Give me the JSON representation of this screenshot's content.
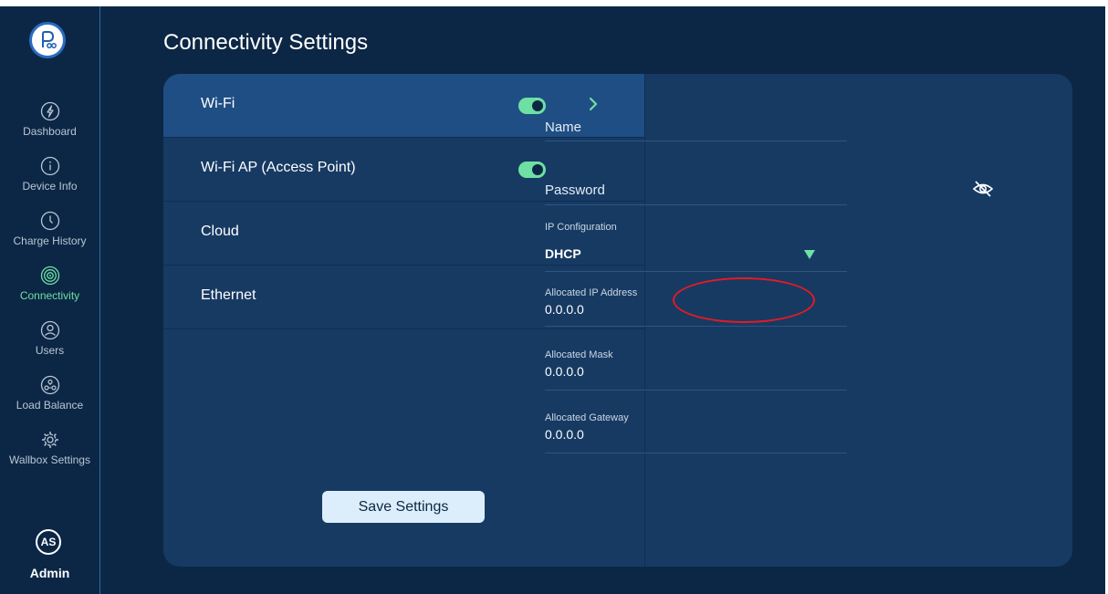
{
  "page": {
    "title": "Connectivity Settings"
  },
  "sidebar": {
    "items": [
      {
        "label": "Dashboard",
        "icon": "lightning-circle-icon"
      },
      {
        "label": "Device Info",
        "icon": "info-circle-icon"
      },
      {
        "label": "Charge History",
        "icon": "clock-icon"
      },
      {
        "label": "Connectivity",
        "icon": "signal-icon",
        "active": true
      },
      {
        "label": "Users",
        "icon": "user-icon"
      },
      {
        "label": "Load Balance",
        "icon": "load-balance-icon"
      },
      {
        "label": "Wallbox Settings",
        "icon": "gear-icon"
      }
    ],
    "user": {
      "initials": "AS",
      "name": "Admin"
    }
  },
  "connections": [
    {
      "label": "Wi-Fi",
      "enabled": true,
      "selected": true
    },
    {
      "label": "Wi-Fi AP (Access Point)",
      "enabled": true,
      "selected": false
    },
    {
      "label": "Cloud",
      "selected": false
    },
    {
      "label": "Ethernet",
      "selected": false
    }
  ],
  "save_button": "Save Settings",
  "form": {
    "name_label": "Name",
    "password_label": "Password",
    "ip_config_label": "IP Configuration",
    "ip_config_value": "DHCP",
    "allocated_ip_label": "Allocated IP Address",
    "allocated_ip_value": "0.0.0.0",
    "allocated_mask_label": "Allocated Mask",
    "allocated_mask_value": "0.0.0.0",
    "allocated_gateway_label": "Allocated Gateway",
    "allocated_gateway_value": "0.0.0.0"
  },
  "colors": {
    "background": "#0c2745",
    "panel": "#173a63",
    "selected_row": "#1f4e84",
    "accent_green": "#6ee0a4",
    "annotation_red": "#e31b23"
  }
}
